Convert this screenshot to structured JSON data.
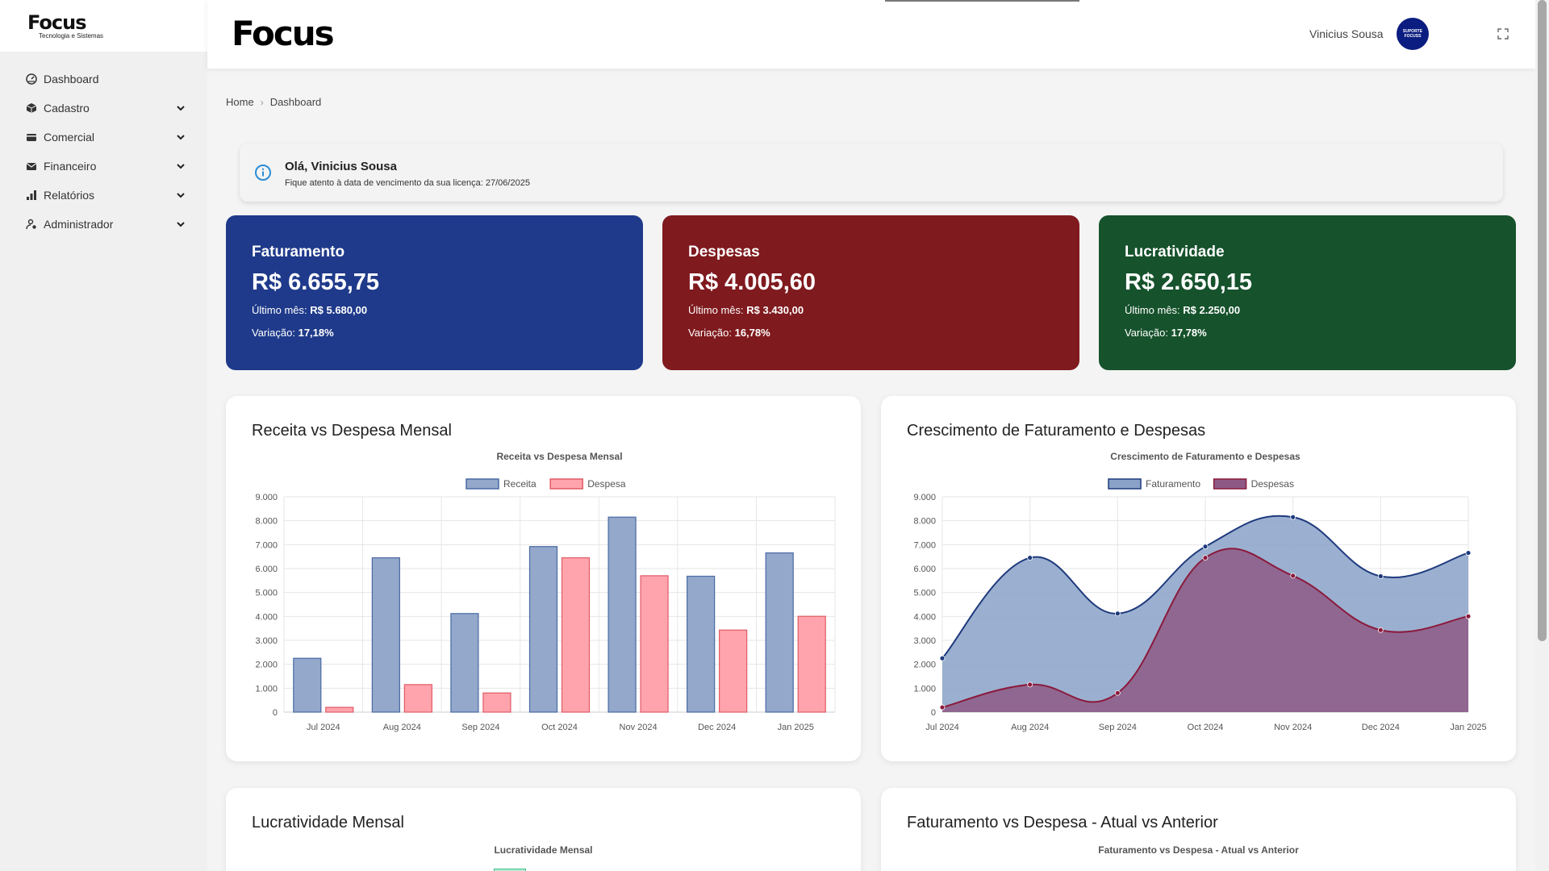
{
  "sidebar": {
    "logo": "Focus",
    "logo_sub": "Tecnologia e Sistemas",
    "items": [
      {
        "label": "Dashboard",
        "icon": "dashboard-icon",
        "expandable": false
      },
      {
        "label": "Cadastro",
        "icon": "box-icon",
        "expandable": true
      },
      {
        "label": "Comercial",
        "icon": "wallet-icon",
        "expandable": true
      },
      {
        "label": "Financeiro",
        "icon": "envelope-icon",
        "expandable": true
      },
      {
        "label": "Relatórios",
        "icon": "bar-chart-icon",
        "expandable": true
      },
      {
        "label": "Administrador",
        "icon": "user-gear-icon",
        "expandable": true
      }
    ]
  },
  "header": {
    "logo": "Focus",
    "user_name": "Vinicius Sousa",
    "avatar_text": "SUPORTE FOCUSS",
    "avatar_color": "#0b1d80"
  },
  "breadcrumb": {
    "home": "Home",
    "current": "Dashboard"
  },
  "alert": {
    "title": "Olá, Vinicius Sousa",
    "text": "Fique atento à data de vencimento da sua licença: 27/06/2025"
  },
  "kpis": [
    {
      "title": "Faturamento",
      "value": "R$ 6.655,75",
      "last_label": "Último mês:",
      "last_value": "R$ 5.680,00",
      "var_label": "Variação:",
      "var_value": "17,18%",
      "color": "#1f3a8a"
    },
    {
      "title": "Despesas",
      "value": "R$ 4.005,60",
      "last_label": "Último mês:",
      "last_value": "R$ 3.430,00",
      "var_label": "Variação:",
      "var_value": "16,78%",
      "color": "#7f1a1e"
    },
    {
      "title": "Lucratividade",
      "value": "R$ 2.650,15",
      "last_label": "Último mês:",
      "last_value": "R$ 2.250,00",
      "var_label": "Variação:",
      "var_value": "17,78%",
      "color": "#16522c"
    }
  ],
  "cards": {
    "bar_title": "Receita vs Despesa Mensal",
    "line_title": "Crescimento de Faturamento e Despesas",
    "bottom_left_title": "Lucratividade Mensal",
    "bottom_right_title": "Faturamento vs Despesa - Atual vs Anterior",
    "bottom_left_chart_title": "Lucratividade Mensal",
    "bottom_right_chart_title": "Faturamento vs Despesa - Atual vs Anterior"
  },
  "chart_data": [
    {
      "type": "bar",
      "title": "Receita vs Despesa Mensal",
      "categories": [
        "Jul 2024",
        "Aug 2024",
        "Sep 2024",
        "Oct 2024",
        "Nov 2024",
        "Dec 2024",
        "Jan 2025"
      ],
      "series": [
        {
          "name": "Receita",
          "values": [
            2250,
            6450,
            4120,
            6920,
            8150,
            5680,
            6655
          ],
          "fill": "#93a8ca",
          "stroke": "#4a6aa5"
        },
        {
          "name": "Despesa",
          "values": [
            200,
            1150,
            800,
            6450,
            5700,
            3430,
            4005
          ],
          "fill": "#ffa4ac",
          "stroke": "#e05a65"
        }
      ],
      "ylim": [
        0,
        9000
      ],
      "yticks": [
        "0",
        "1.000",
        "2.000",
        "3.000",
        "4.000",
        "5.000",
        "6.000",
        "7.000",
        "8.000",
        "9.000"
      ],
      "legend": "top",
      "grid": true
    },
    {
      "type": "area",
      "title": "Crescimento de Faturamento e Despesas",
      "categories": [
        "Jul 2024",
        "Aug 2024",
        "Sep 2024",
        "Oct 2024",
        "Nov 2024",
        "Dec 2024",
        "Jan 2025"
      ],
      "series": [
        {
          "name": "Faturamento",
          "values": [
            2250,
            6450,
            4120,
            6920,
            8150,
            5680,
            6655
          ],
          "fill": "#8aa2c8",
          "stroke": "#1e3a7d"
        },
        {
          "name": "Despesas",
          "values": [
            200,
            1150,
            800,
            6450,
            5700,
            3430,
            4005
          ],
          "fill": "#8e5a85",
          "stroke": "#8b1a3c"
        }
      ],
      "ylim": [
        0,
        9000
      ],
      "yticks": [
        "0",
        "1.000",
        "2.000",
        "3.000",
        "4.000",
        "5.000",
        "6.000",
        "7.000",
        "8.000",
        "9.000"
      ],
      "legend": "top",
      "grid": true
    }
  ]
}
